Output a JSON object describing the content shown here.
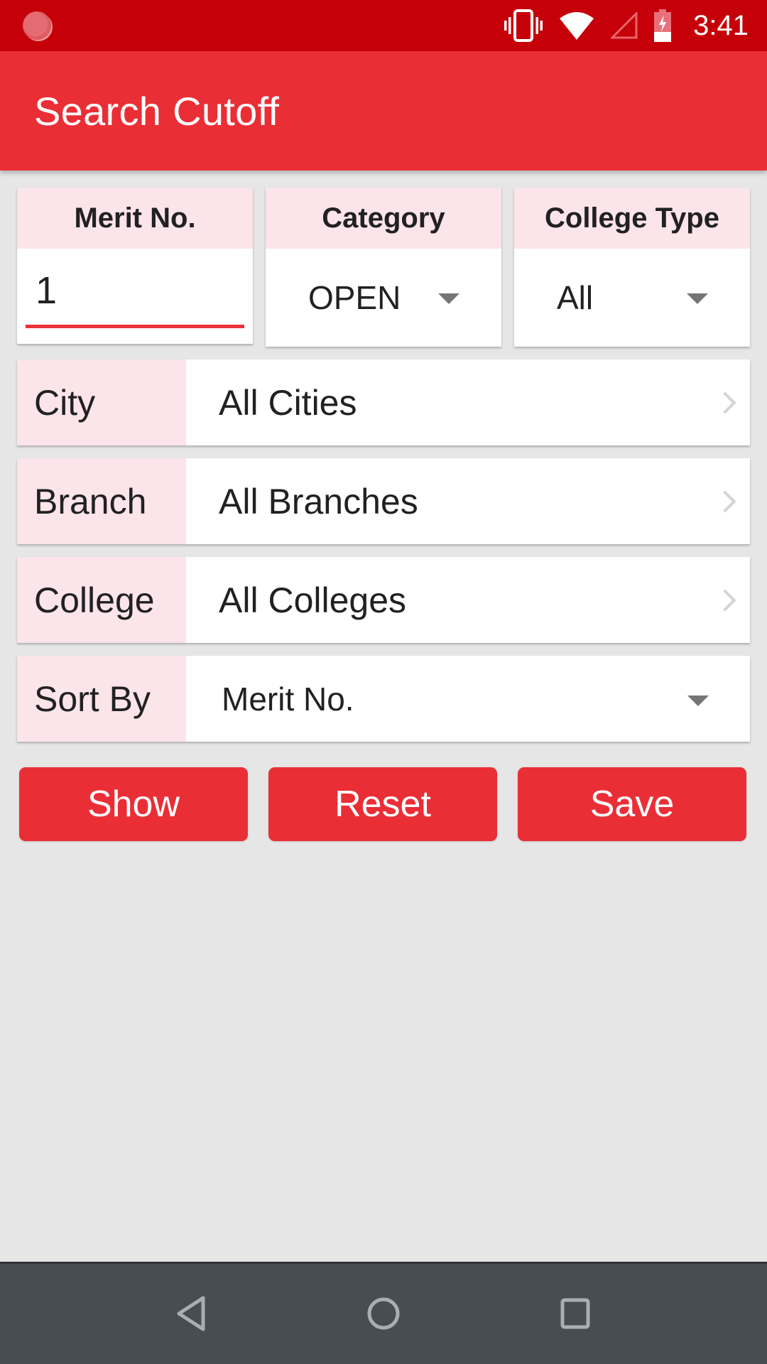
{
  "status_bar": {
    "time": "3:41",
    "icons": [
      "app-notification-icon",
      "vibrate-icon",
      "wifi-icon",
      "cell-signal-icon",
      "battery-charging-icon"
    ]
  },
  "app_bar": {
    "title": "Search Cutoff"
  },
  "filters": {
    "merit": {
      "label": "Merit No.",
      "value": "1"
    },
    "category": {
      "label": "Category",
      "value": "OPEN"
    },
    "college_type": {
      "label": "College Type",
      "value": "All"
    },
    "city": {
      "label": "City",
      "value": "All Cities"
    },
    "branch": {
      "label": "Branch",
      "value": "All Branches"
    },
    "college": {
      "label": "College",
      "value": "All Colleges"
    },
    "sort_by": {
      "label": "Sort By",
      "value": "Merit No."
    }
  },
  "actions": {
    "show": "Show",
    "reset": "Reset",
    "save": "Save"
  },
  "colors": {
    "status_bar": "#c50009",
    "primary": "#ea2e36",
    "label_bg": "#fbe4ea",
    "background": "#e6e6e6",
    "nav_bar": "#474d52"
  },
  "nav_bar": {
    "icons": [
      "back-icon",
      "home-icon",
      "recent-apps-icon"
    ]
  }
}
